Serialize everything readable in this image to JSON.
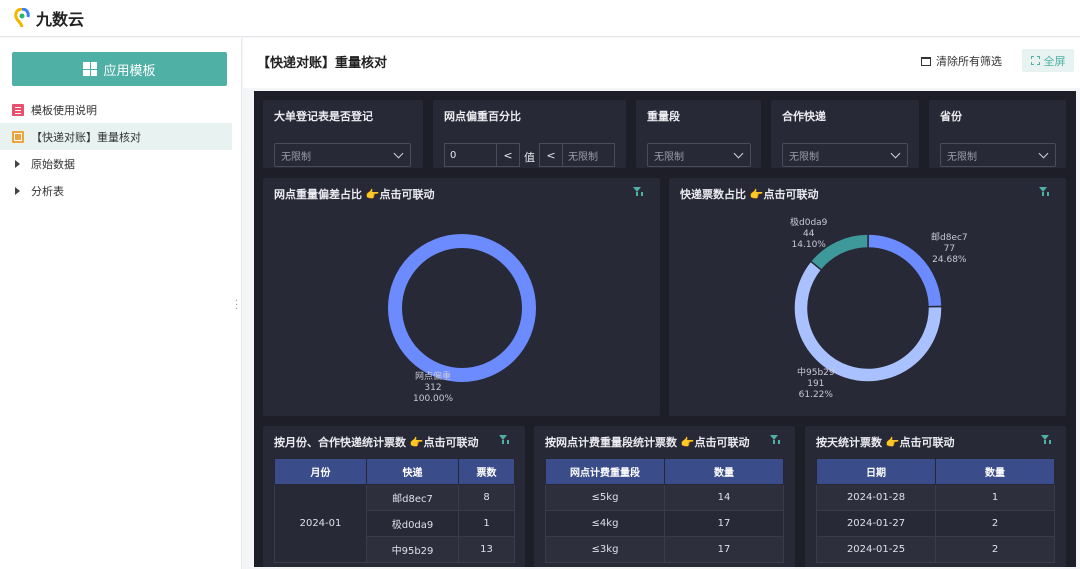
{
  "app": {
    "name": "九数云"
  },
  "sidebar": {
    "apply_button": "应用模板",
    "items": [
      {
        "label": "模板使用说明"
      },
      {
        "label": "【快递对账】重量核对"
      },
      {
        "label": "原始数据"
      },
      {
        "label": "分析表"
      }
    ]
  },
  "header": {
    "title": "【快递对账】重量核对",
    "clear_filters": "清除所有筛选",
    "fullscreen": "全屏"
  },
  "filters": {
    "registered": {
      "label": "大单登记表是否登记",
      "value": "无限制"
    },
    "deviation_pct": {
      "label": "网点偏重百分比",
      "min": "0",
      "op1": "<",
      "op2": "<",
      "mid": "值",
      "max": "无限制"
    },
    "weight_range": {
      "label": "重量段",
      "value": "无限制"
    },
    "courier": {
      "label": "合作快递",
      "value": "无限制"
    },
    "province": {
      "label": "省份",
      "value": "无限制"
    }
  },
  "charts": {
    "deviation": {
      "title": "网点重量偏差占比 👉点击可联动",
      "chart_data": {
        "type": "pie",
        "title": "网点重量偏差占比 👉点击可联动",
        "slices": [
          {
            "label": "网点偏重",
            "value": 312,
            "percent": "100.00%",
            "color": "#6b8bff"
          }
        ]
      }
    },
    "courier_share": {
      "title": "快递票数占比 👉点击可联动",
      "chart_data": {
        "type": "pie",
        "title": "快递票数占比 👉点击可联动",
        "slices": [
          {
            "label": "邮d8ec7",
            "value": 77,
            "percent": "24.68%",
            "color": "#6b8bff"
          },
          {
            "label": "中95b29",
            "value": 191,
            "percent": "61.22%",
            "color": "#a9c1ff"
          },
          {
            "label": "极d0da9",
            "value": 44,
            "percent": "14.10%",
            "color": "#3e9a9a"
          }
        ]
      }
    }
  },
  "tables": {
    "by_month": {
      "title": "按月份、合作快递统计票数 👉点击可联动",
      "headers": [
        "月份",
        "快递",
        "票数"
      ],
      "month": "2024-01",
      "rows": [
        {
          "courier": "邮d8ec7",
          "count": "8"
        },
        {
          "courier": "极d0da9",
          "count": "1"
        },
        {
          "courier": "中95b29",
          "count": "13"
        }
      ]
    },
    "by_weight": {
      "title": "按网点计费重量段统计票数 👉点击可联动",
      "headers": [
        "网点计费重量段",
        "数量"
      ],
      "rows": [
        {
          "range": "≤5kg",
          "count": "14"
        },
        {
          "range": "≤4kg",
          "count": "17"
        },
        {
          "range": "≤3kg",
          "count": "17"
        }
      ]
    },
    "by_day": {
      "title": "按天统计票数 👉点击可联动",
      "headers": [
        "日期",
        "数量"
      ],
      "rows": [
        {
          "date": "2024-01-28",
          "count": "1"
        },
        {
          "date": "2024-01-27",
          "count": "2"
        },
        {
          "date": "2024-01-25",
          "count": "2"
        }
      ]
    }
  }
}
